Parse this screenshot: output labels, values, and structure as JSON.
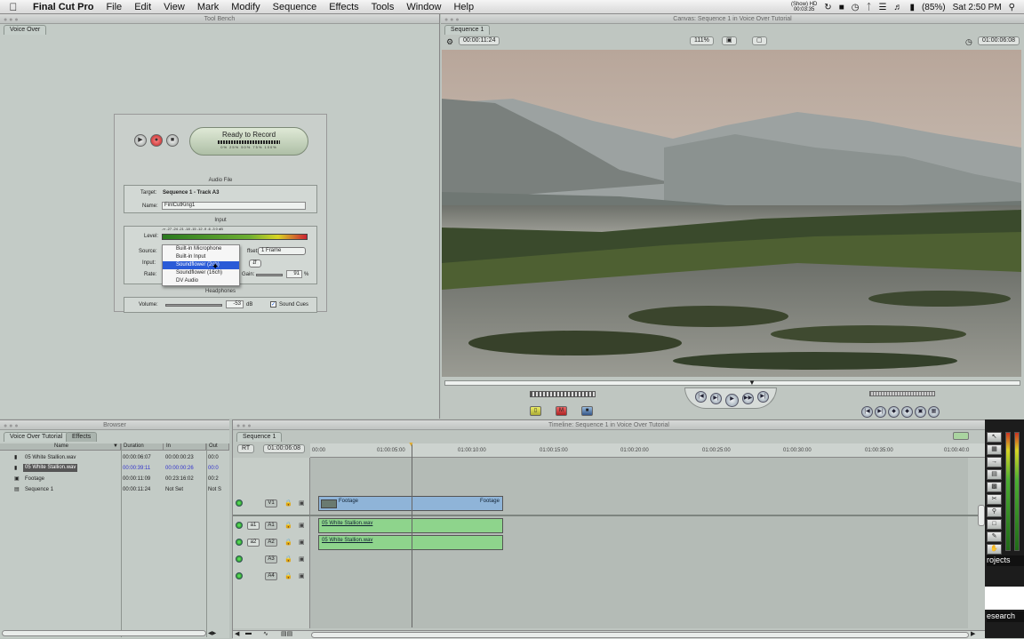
{
  "menubar": {
    "apple": "",
    "app_name": "Final Cut Pro",
    "items": [
      "File",
      "Edit",
      "View",
      "Mark",
      "Modify",
      "Sequence",
      "Effects",
      "Tools",
      "Window",
      "Help"
    ],
    "status": {
      "show_hd": "(Show) HD",
      "show_time": "00:03:35",
      "battery": "(85%)",
      "clock": "Sat 2:50 PM"
    }
  },
  "tool_bench": {
    "title": "Tool Bench",
    "tab": "Voice Over",
    "status": "Ready to Record",
    "meter_ticks": "0%  25%  50%  75%  100%",
    "audio_file_label": "Audio File",
    "target_label": "Target:",
    "target_value": "Sequence 1 - Track A3",
    "name_label": "Name:",
    "name_value": "FinlCutKing1",
    "input_label": "Input",
    "level_label": "Level:",
    "level_scale": "-∞  -27  -24  -21  -18  -15  -12  -9  -6  -3  0  dB",
    "source_label": "Source:",
    "input_field_label": "Input:",
    "rate_label": "Rate:",
    "offset_label": "ffset:",
    "offset_value": "1 Frame",
    "gain_label": "Gain:",
    "gain_value": "91",
    "gain_unit": "%",
    "headphones_label": "Headphones",
    "volume_label": "Volume:",
    "volume_value": "-53",
    "volume_unit": "dB",
    "sound_cues_label": "Sound Cues",
    "sound_cues_checked": true,
    "popup_options": [
      "Built-in Microphone",
      "Built-in Input",
      "Soundflower (2ch)",
      "Soundflower (16ch)",
      "DV Audio"
    ],
    "popup_selected_index": 2
  },
  "canvas": {
    "title": "Canvas: Sequence 1 in Voice Over Tutorial",
    "tab": "Sequence 1",
    "duration": "00:00:11:24",
    "zoom": "111%",
    "current_timecode": "01:00:06:08"
  },
  "browser": {
    "title": "Browser",
    "tabs": [
      "Voice Over Tutorial",
      "Effects"
    ],
    "columns": [
      "Name",
      "Duration",
      "In",
      "Out"
    ],
    "rows": [
      {
        "name": "05 White Stallion.wav",
        "duration": "00:00:06:07",
        "in": "00:00:00:23",
        "out": "00:0",
        "selected": false
      },
      {
        "name": "05 White Stallion.wav",
        "duration": "00:00:39:11",
        "in": "00:00:00:26",
        "out": "00:0",
        "selected": true
      },
      {
        "name": "Footage",
        "duration": "00:00:11:09",
        "in": "00:23:16:02",
        "out": "00:2",
        "selected": false
      },
      {
        "name": "Sequence 1",
        "duration": "00:00:11:24",
        "in": "Not Set",
        "out": "Not S",
        "selected": false
      }
    ]
  },
  "timeline": {
    "title": "Timeline: Sequence 1 in Voice Over Tutorial",
    "tab": "Sequence 1",
    "rt": "RT",
    "current_timecode": "01:00:06:08",
    "ruler": [
      "00:00",
      "01:00:05:00",
      "01:00:10:00",
      "01:00:15:00",
      "01:00:20:00",
      "01:00:25:00",
      "01:00:30:00",
      "01:00:35:00",
      "01:00:40:0"
    ],
    "tracks": [
      {
        "src": "",
        "dest": "V1"
      },
      {
        "src": "a1",
        "dest": "A1"
      },
      {
        "src": "a2",
        "dest": "A2"
      },
      {
        "src": "",
        "dest": "A3"
      },
      {
        "src": "",
        "dest": "A4"
      }
    ],
    "clips": {
      "video_left": "Footage",
      "video_right": "Footage",
      "audio1": "05 White Stallion.wav",
      "audio2": "05 White Stallion.wav"
    }
  },
  "background_window": {
    "text1": "rojects",
    "text2": "esearch"
  }
}
